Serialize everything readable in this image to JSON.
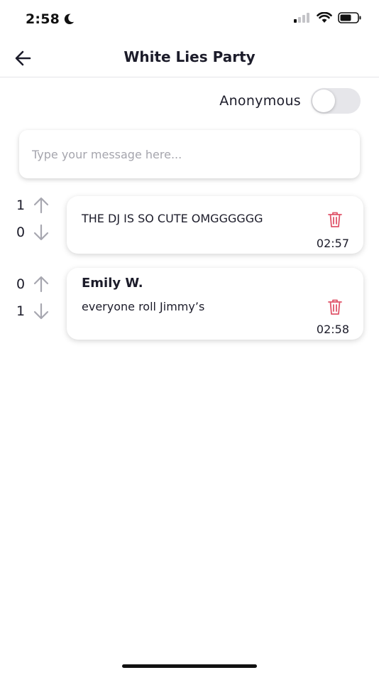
{
  "status_bar": {
    "time": "2:58"
  },
  "header": {
    "title": "White Lies Party"
  },
  "anonymous": {
    "label": "Anonymous",
    "enabled": false
  },
  "composer": {
    "placeholder": "Type your message here..."
  },
  "messages": [
    {
      "upvotes": "1",
      "downvotes": "0",
      "author": "",
      "text": "THE DJ IS SO CUTE OMGGGGGG",
      "time": "02:57"
    },
    {
      "upvotes": "0",
      "downvotes": "1",
      "author": "Emily W.",
      "text": "everyone roll Jimmy’s",
      "time": "02:58"
    }
  ],
  "colors": {
    "delete": "#e0566b",
    "arrow": "#a7a7b0",
    "toggle_off": "#e6e6ea"
  }
}
